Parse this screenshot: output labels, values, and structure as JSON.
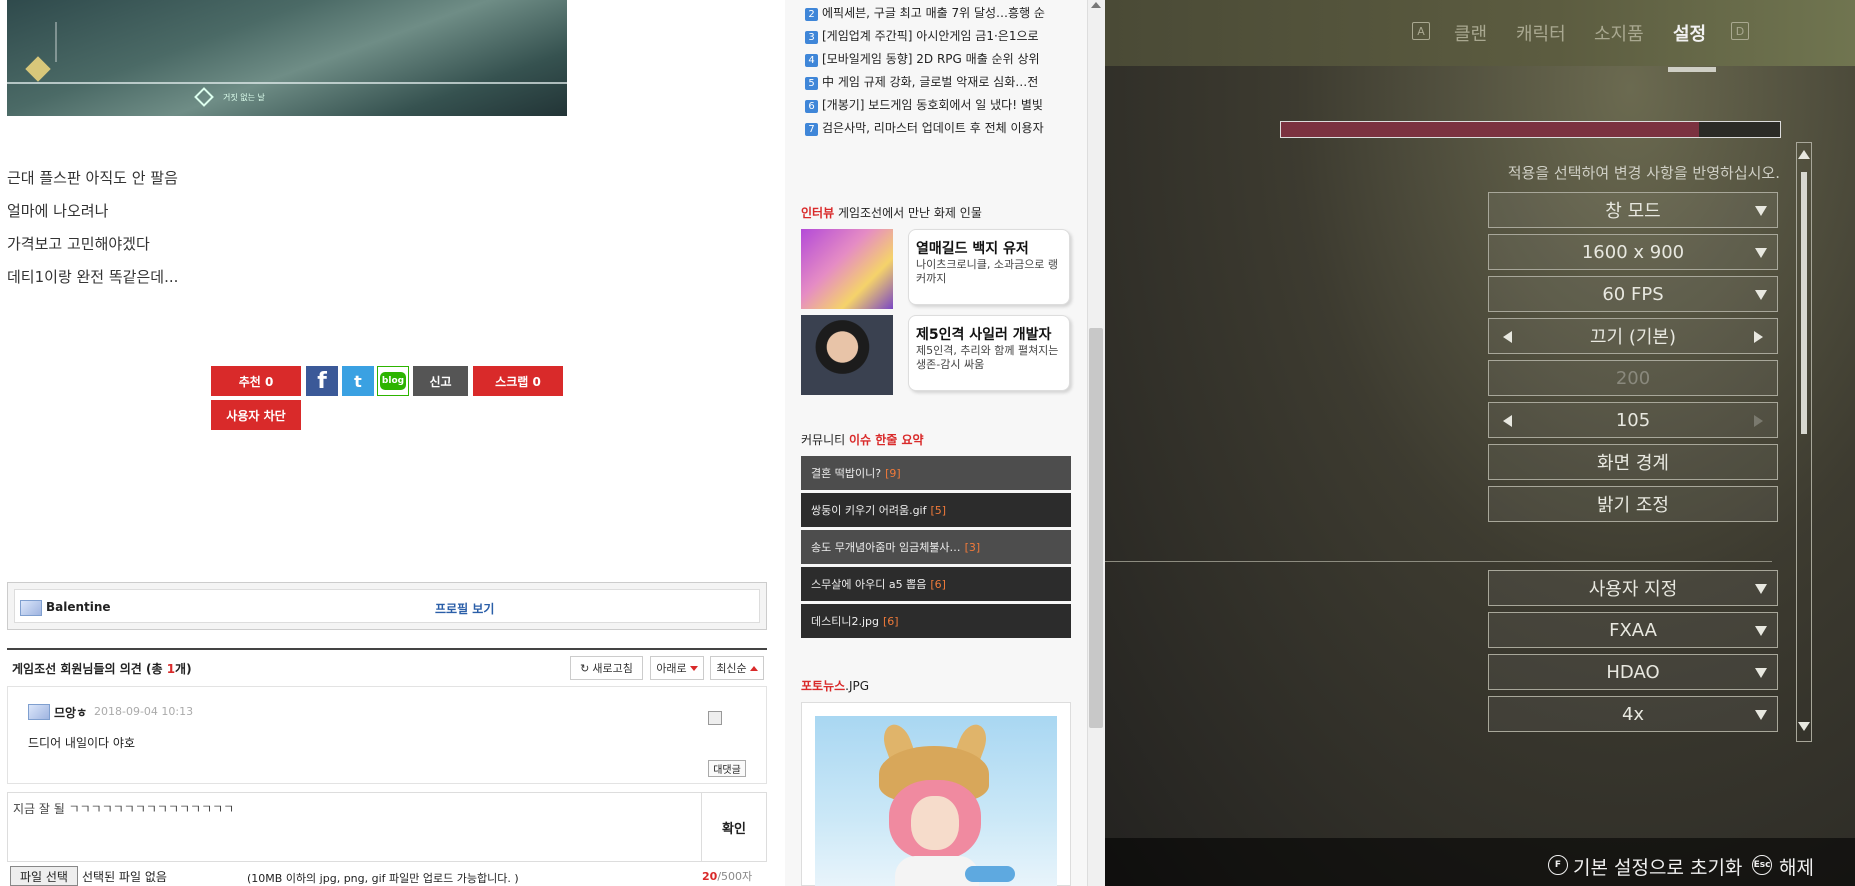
{
  "post": {
    "image_caption": "거짓 없는 날",
    "lines": [
      "근대 플스판 아직도 안 팔음",
      "얼마에 나오려나",
      "가격보고 고민해야겠다",
      "데티1이랑 완전 똑같은데..."
    ],
    "buttons": {
      "recommend": "추천 0",
      "facebook": "f",
      "twitter": "t",
      "blog": "blog",
      "report": "신고",
      "scrap": "스크랩 0",
      "block_user": "사용자 차단"
    },
    "profile": {
      "name": "Balentine",
      "link": "프로필 보기"
    }
  },
  "comments": {
    "title_prefix": "게임조선 회원님들의 의견 (총 ",
    "count": "1",
    "title_suffix": "개)",
    "refresh": "새로고침",
    "sort_down": "아래로",
    "sort_latest": "최신순",
    "items": [
      {
        "author": "므앙ㅎ",
        "date": "2018-09-04 10:13",
        "text": "드디어 내일이다 야호",
        "reply": "대댓글"
      }
    ],
    "form": {
      "input_text": "지금 잘 될 ㄱㄱㄱㄱㄱㄱㄱㄱㄱㄱㄱㄱㄱㄱㄱ",
      "submit": "확인",
      "file_button": "파일 선택",
      "file_status": "선택된 파일 없음",
      "file_note": "(10MB 이하의 jpg, png, gif 파일만 업로드 가능합니다. )",
      "char_used": "20",
      "char_max": "/500자"
    }
  },
  "sidebar": {
    "news": [
      {
        "num": "2",
        "text": "에픽세븐, 구글 최고 매출 7위 달성…흥행 순"
      },
      {
        "num": "3",
        "text": "[게임업계 주간픽] 아시안게임 금1·은1으로"
      },
      {
        "num": "4",
        "text": "[모바일게임 동향] 2D RPG 매출 순위 상위"
      },
      {
        "num": "5",
        "text": "中 게임 규제 강화, 글로벌 악재로 심화…전"
      },
      {
        "num": "6",
        "text": "[개봉기] 보드게임 동호회에서 일 냈다! 별빛"
      },
      {
        "num": "7",
        "text": "검은사막, 리마스터 업데이트 후 전체 이용자"
      }
    ],
    "interview": {
      "title_red": "인터뷰",
      "title_rest": " 게임조선에서 만난 화제 인물",
      "items": [
        {
          "name": "열매길드 백지 유저",
          "desc": "나이츠크로니클, 소과금으로 랭커까지"
        },
        {
          "name": "제5인격 사일러 개발자",
          "desc": "제5인격, 추리와 함께 펼쳐지는 생존-감시 싸움"
        }
      ]
    },
    "community": {
      "title_prefix": "커뮤니티 ",
      "title_red": "이슈 한줄 요약",
      "items": [
        {
          "text": "결혼 떡밥이니? ",
          "count": "[9]"
        },
        {
          "text": "쌍둥이 키우기 어려움.gif ",
          "count": "[5]"
        },
        {
          "text": "송도 무개념아줌마 임금체불사… ",
          "count": "[3]"
        },
        {
          "text": "스무살에 아우디 a5 뽑음 ",
          "count": "[6]"
        },
        {
          "text": "데스티니2.jpg ",
          "count": "[6]"
        }
      ]
    },
    "photo_news": {
      "title_red": "포토뉴스",
      "title_rest": ".JPG"
    }
  },
  "game": {
    "tabs": [
      {
        "label": "클랜",
        "active": false
      },
      {
        "label": "캐릭터",
        "active": false
      },
      {
        "label": "소지품",
        "active": false
      },
      {
        "label": "설정",
        "active": true
      }
    ],
    "key_left": "A",
    "key_right": "D",
    "hint": "적용을 선택하여 변경 사항을 반영하십시오.",
    "settings": [
      {
        "value": "창 모드",
        "control": "dropdown"
      },
      {
        "value": "1600 x 900",
        "control": "dropdown"
      },
      {
        "value": "60 FPS",
        "control": "dropdown"
      },
      {
        "value": "끄기 (기본)",
        "control": "stepper"
      },
      {
        "value": "200",
        "control": "disabled"
      },
      {
        "value": "105",
        "control": "stepper-max"
      },
      {
        "value": "화면 경계",
        "control": "button"
      },
      {
        "value": "밝기 조정",
        "control": "button"
      },
      {
        "value": "사용자 지정",
        "control": "dropdown"
      },
      {
        "value": "FXAA",
        "control": "dropdown"
      },
      {
        "value": "HDAO",
        "control": "dropdown"
      },
      {
        "value": "4x",
        "control": "dropdown"
      }
    ],
    "bottom": {
      "reset_key": "F",
      "reset_label": "기본 설정으로 초기화",
      "close_key": "Esc",
      "close_label": "해제"
    },
    "colors": {
      "accent_bar": "#7b3240",
      "active_tab": "#f2f2f2"
    }
  }
}
